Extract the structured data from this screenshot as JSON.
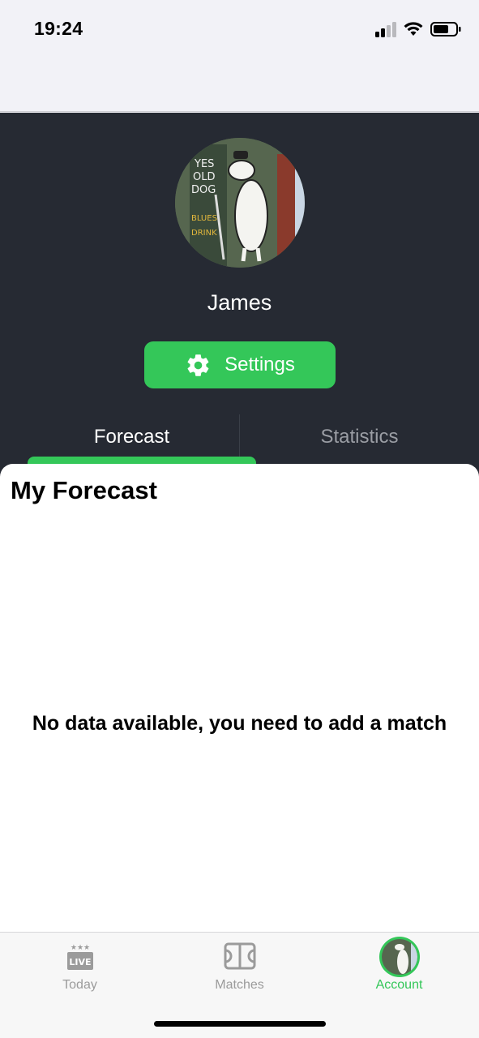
{
  "status_bar": {
    "time": "19:24"
  },
  "profile": {
    "username": "James",
    "settings_label": "Settings",
    "avatar_sign_lines": [
      "YES",
      "OLD",
      "DOG",
      "BLUES",
      "DRINK"
    ]
  },
  "tabs": [
    {
      "label": "Forecast",
      "active": true
    },
    {
      "label": "Statistics",
      "active": false
    }
  ],
  "forecast": {
    "title": "My Forecast",
    "empty_message": "No data available, you need to add a match"
  },
  "tabbar": {
    "items": [
      {
        "label": "Today",
        "icon": "live-icon",
        "badge": "LIVE",
        "active": false
      },
      {
        "label": "Matches",
        "icon": "field-icon",
        "active": false
      },
      {
        "label": "Account",
        "icon": "avatar-icon",
        "active": true
      }
    ]
  },
  "colors": {
    "accent": "#34c759",
    "header_bg": "#262a33",
    "inactive": "#9b9b9b"
  }
}
